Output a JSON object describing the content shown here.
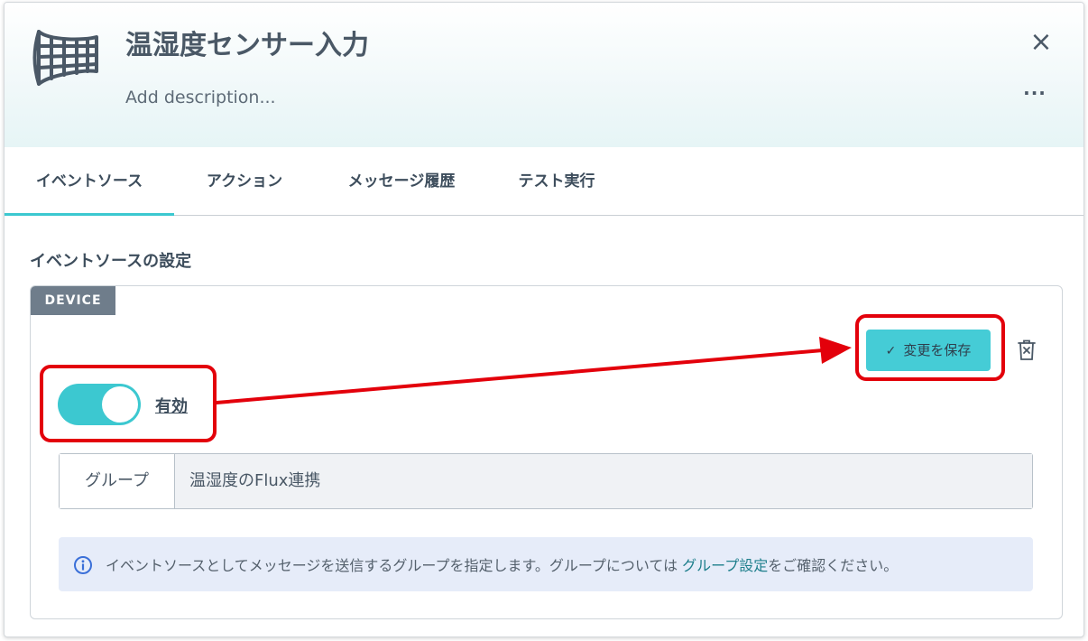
{
  "header": {
    "title": "温湿度センサー入力",
    "description_placeholder": "Add description...",
    "close_icon": "×",
    "more_icon": "···"
  },
  "tabs": [
    {
      "label": "イベントソース",
      "active": true
    },
    {
      "label": "アクション",
      "active": false
    },
    {
      "label": "メッセージ履歴",
      "active": false
    },
    {
      "label": "テスト実行",
      "active": false
    }
  ],
  "section": {
    "title": "イベントソースの設定"
  },
  "card": {
    "badge": "DEVICE",
    "save_button": {
      "icon": "✓",
      "label": "変更を保存"
    },
    "toggle": {
      "enabled": true,
      "label": "有効"
    },
    "group": {
      "label": "グループ",
      "value": "温湿度のFlux連携"
    },
    "info": {
      "text_before": "イベントソースとしてメッセージを送信するグループを指定します。グループについては ",
      "link": "グループ設定",
      "text_after": "をご確認ください。"
    }
  },
  "colors": {
    "accent": "#3cc8d0",
    "annotation": "#e3000b",
    "badge": "#6f7d8b",
    "info_bg": "#e6ecf9"
  }
}
